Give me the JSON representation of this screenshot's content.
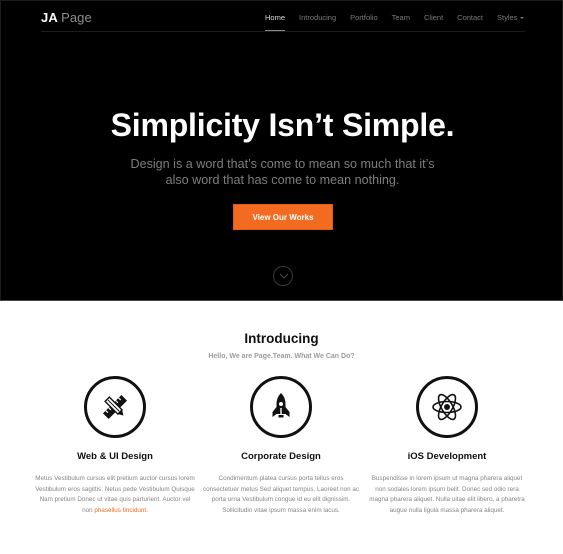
{
  "header": {
    "logo_primary": "JA",
    "logo_secondary": "Page",
    "nav": [
      {
        "label": "Home",
        "active": true
      },
      {
        "label": "Introducing",
        "active": false
      },
      {
        "label": "Portfolio",
        "active": false
      },
      {
        "label": "Team",
        "active": false
      },
      {
        "label": "Client",
        "active": false
      },
      {
        "label": "Contact",
        "active": false
      },
      {
        "label": "Styles",
        "active": false,
        "has_dropdown": true
      }
    ]
  },
  "hero": {
    "title": "Simplicity Isn’t Simple.",
    "subtitle": "Design is a word that’s come to mean so much that it’s also word that has come to mean nothing.",
    "cta_label": "View Our Works",
    "scroll_icon": "chevron-down-circle-icon"
  },
  "intro": {
    "title": "Introducing",
    "subtitle": "Hello, We are Page.Team. What We Can Do?",
    "features": [
      {
        "icon": "pencil-ruler-icon",
        "title": "Web & UI Design",
        "text": "Metus Vestibulum cursus elit pretium auctor cursus lorem Vestibulum eros sagittis. Netus pede Vestibulum Quisque Nam pretium Donec ut vitae quis parturient. Auctor vel non ",
        "link_text": "phasellus tincidunt",
        "text_end": "."
      },
      {
        "icon": "rocket-icon",
        "title": "Corporate Design",
        "text": "Condimentum platea cursus porta tellus eros consectetuer metus Sed aliquet tempus. Laoreet non ac porta urna Vestibulum congue id eu elit dignissim. Sollicitudin vitae ipsum massa enim lacus."
      },
      {
        "icon": "atom-icon",
        "title": "iOS Development",
        "text": "Buspendisse in lorem ipsum ut magna pharera aliquet non sodales lorem ipsum belit. Donec sed odio rera magna pharera aliquet. Nulla uitae elit libero, a pharetra augue nulla ligula massa pharera aliquet."
      }
    ]
  },
  "colors": {
    "accent": "#f26b21",
    "hero_bg": "#000000",
    "text_muted": "#858585"
  }
}
